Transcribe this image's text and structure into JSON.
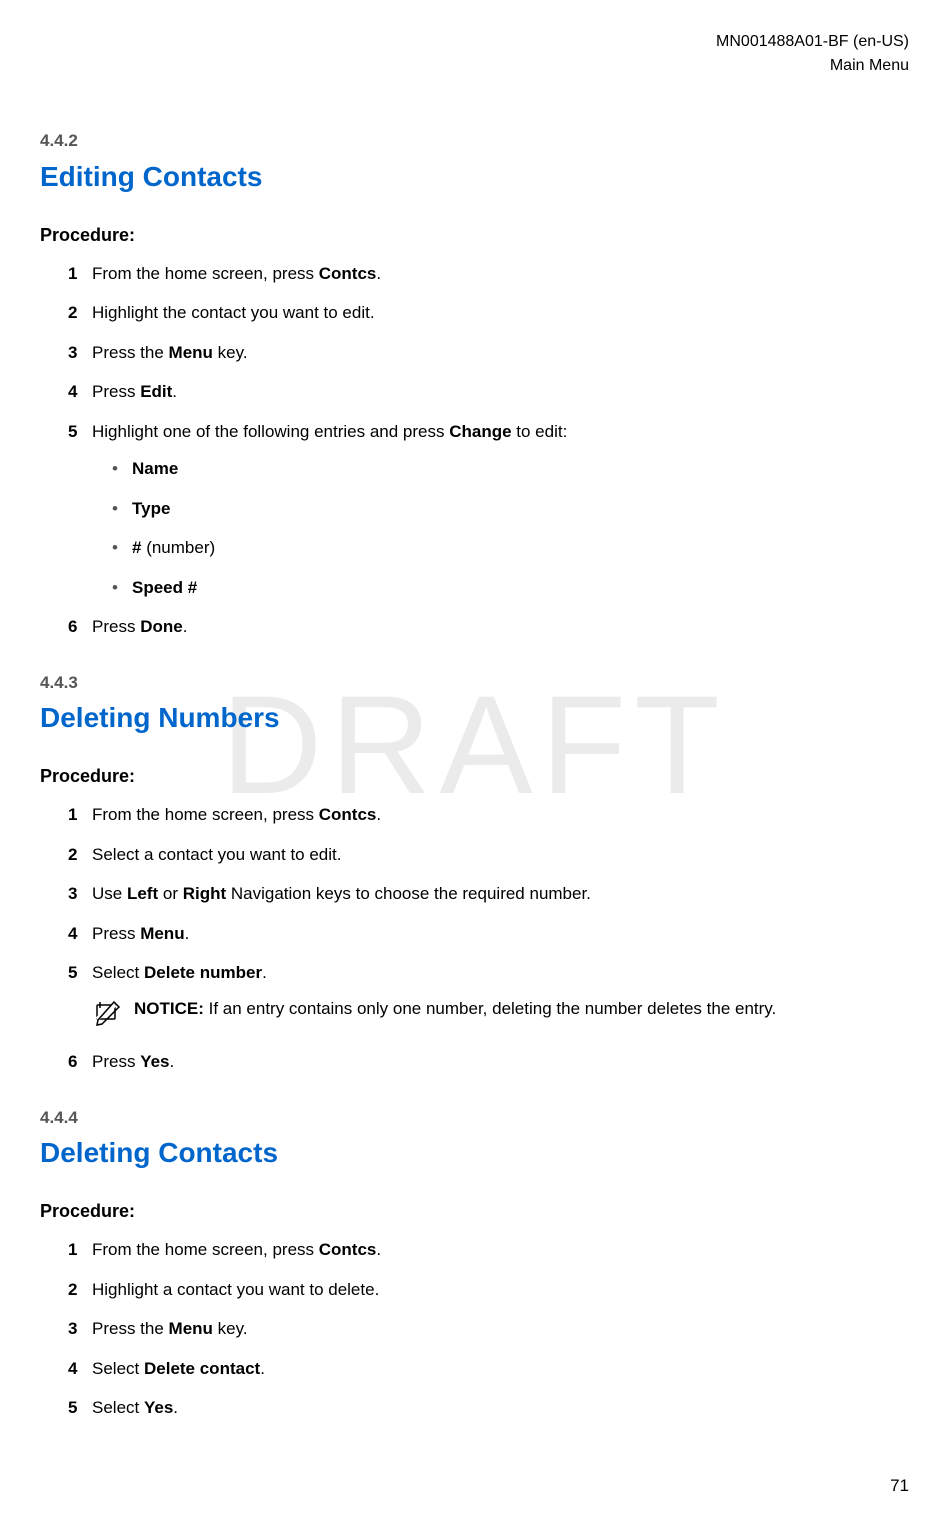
{
  "header": {
    "doc_id": "MN001488A01-BF (en-US)",
    "section": "Main Menu"
  },
  "watermark": "DRAFT",
  "page_number": "71",
  "sections": [
    {
      "number": "4.4.2",
      "title": "Editing Contacts",
      "procedure_label": "Procedure:",
      "steps": [
        {
          "num": "1",
          "prefix": "From the home screen, press ",
          "bold1": "Contcs",
          "suffix": "."
        },
        {
          "num": "2",
          "text": "Highlight the contact you want to edit."
        },
        {
          "num": "3",
          "prefix": "Press the ",
          "bold1": "Menu",
          "suffix": " key."
        },
        {
          "num": "4",
          "prefix": "Press ",
          "bold1": "Edit",
          "suffix": "."
        },
        {
          "num": "5",
          "prefix": "Highlight one of the following entries and press ",
          "bold1": "Change",
          "suffix": " to edit:",
          "sub": [
            {
              "bold": "Name"
            },
            {
              "bold": "Type"
            },
            {
              "bold": "#",
              "after": " (number)"
            },
            {
              "bold": "Speed #"
            }
          ]
        },
        {
          "num": "6",
          "prefix": "Press ",
          "bold1": "Done",
          "suffix": "."
        }
      ]
    },
    {
      "number": "4.4.3",
      "title": "Deleting Numbers",
      "procedure_label": "Procedure:",
      "steps": [
        {
          "num": "1",
          "prefix": "From the home screen, press ",
          "bold1": "Contcs",
          "suffix": "."
        },
        {
          "num": "2",
          "text": "Select a contact you want to edit."
        },
        {
          "num": "3",
          "prefix": "Use ",
          "bold1": "Left",
          "mid": " or ",
          "bold2": "Right",
          "suffix": " Navigation keys to choose the required number."
        },
        {
          "num": "4",
          "prefix": "Press ",
          "bold1": "Menu",
          "suffix": "."
        },
        {
          "num": "5",
          "prefix": "Select ",
          "bold1": "Delete number",
          "suffix": ".",
          "notice": {
            "label": "NOTICE:",
            "text": " If an entry contains only one number, deleting the number deletes the entry."
          }
        },
        {
          "num": "6",
          "prefix": "Press ",
          "bold1": "Yes",
          "suffix": "."
        }
      ]
    },
    {
      "number": "4.4.4",
      "title": "Deleting Contacts",
      "procedure_label": "Procedure:",
      "steps": [
        {
          "num": "1",
          "prefix": "From the home screen, press ",
          "bold1": "Contcs",
          "suffix": "."
        },
        {
          "num": "2",
          "text": "Highlight a contact you want to delete."
        },
        {
          "num": "3",
          "prefix": "Press the ",
          "bold1": "Menu",
          "suffix": " key."
        },
        {
          "num": "4",
          "prefix": "Select ",
          "bold1": "Delete contact",
          "suffix": "."
        },
        {
          "num": "5",
          "prefix": "Select ",
          "bold1": "Yes",
          "suffix": "."
        }
      ]
    }
  ]
}
